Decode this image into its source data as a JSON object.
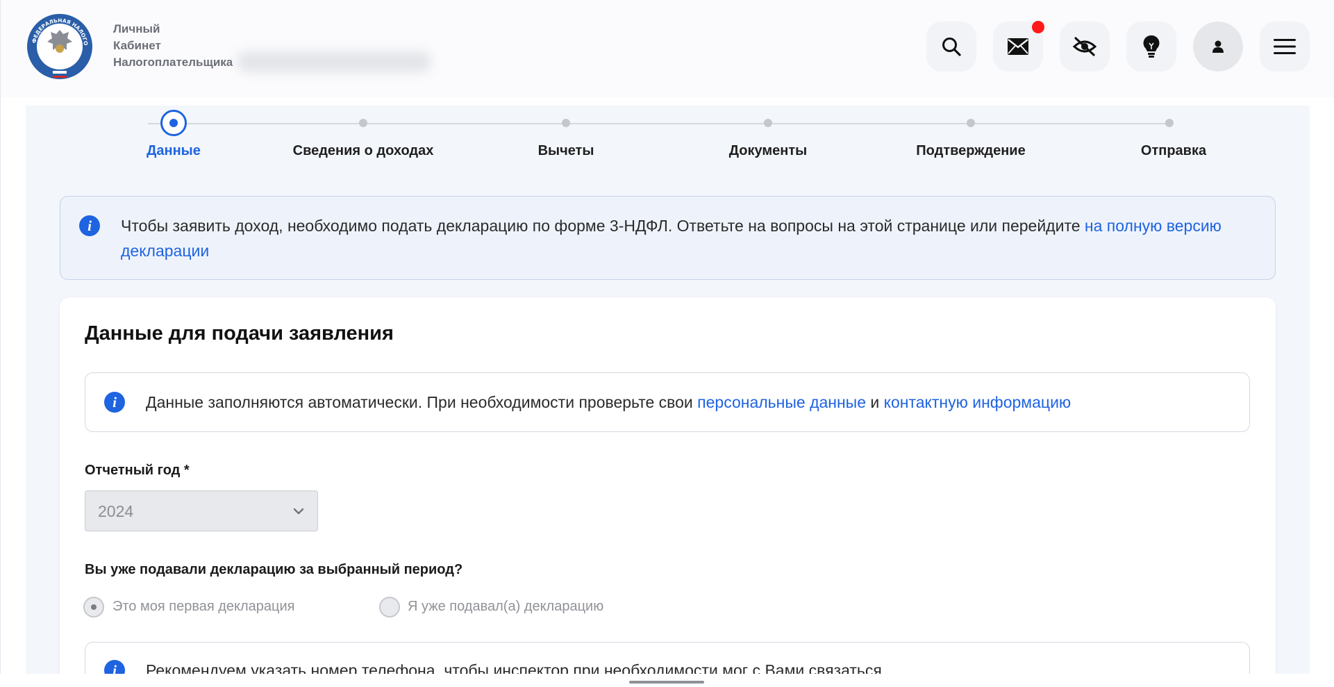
{
  "header": {
    "brand_lines": [
      "Личный",
      "Кабинет",
      "Налогоплательщика"
    ],
    "logo_text": "ФЕДЕРАЛЬНАЯ НАЛОГОВАЯ СЛУЖБА",
    "buttons": [
      "search-icon",
      "mail-icon",
      "eye-off-icon",
      "lightbulb-icon",
      "user-icon",
      "menu-icon"
    ],
    "colors": {
      "badge": "#ff1a1a"
    }
  },
  "stepper": {
    "steps": [
      {
        "label": "Данные",
        "active": true
      },
      {
        "label": "Сведения о доходах",
        "active": false
      },
      {
        "label": "Вычеты",
        "active": false
      },
      {
        "label": "Документы",
        "active": false
      },
      {
        "label": "Подтверждение",
        "active": false
      },
      {
        "label": "Отправка",
        "active": false
      }
    ]
  },
  "notice_top": {
    "text": "Чтобы заявить доход, необходимо подать декларацию по форме 3-НДФЛ. Ответьте на вопросы на этой странице или перейдите ",
    "link_text": "на полную версию декларации"
  },
  "form": {
    "title": "Данные для подачи заявления",
    "notice": {
      "text_before": "Данные заполняются автоматически. При необходимости проверьте свои ",
      "link1": "персональные данные",
      "middle": " и ",
      "link2": "контактную информацию"
    },
    "year_label": "Отчетный год *",
    "year_value": "2024",
    "question": "Вы уже подавали декларацию за выбранный период?",
    "radio_options": [
      {
        "label": "Это моя первая декларация",
        "selected": true
      },
      {
        "label": "Я уже подавал(а) декларацию",
        "selected": false
      }
    ],
    "phone_notice": "Рекомендуем указать номер телефона, чтобы инспектор при необходимости мог с Вами связаться"
  },
  "colors": {
    "accent": "#1e63e0",
    "content_bg": "#f3f6fb"
  }
}
